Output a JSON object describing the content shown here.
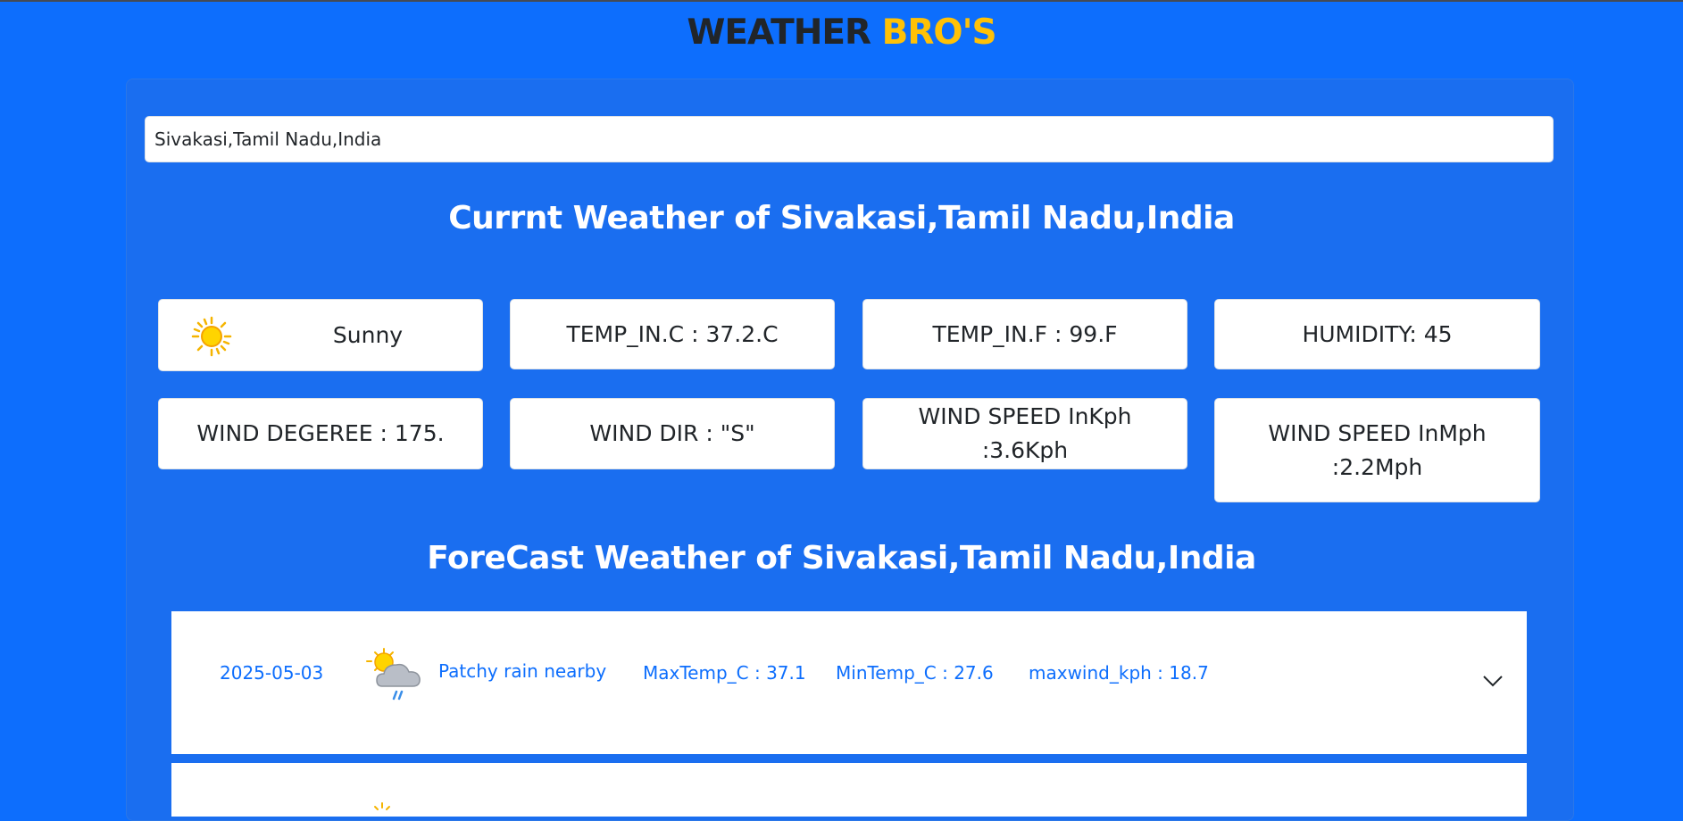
{
  "brand": {
    "part1": "WEATHER",
    "part2": "BRO'S"
  },
  "search": {
    "value": "Sivakasi,Tamil Nadu,India"
  },
  "current": {
    "title": "Currnt Weather of Sivakasi,Tamil Nadu,India",
    "condition": "Sunny",
    "temp_c": "TEMP_IN.C : 37.2.C",
    "temp_f": "TEMP_IN.F : 99.F",
    "humidity": "HUMIDITY: 45",
    "wind_degree": "WIND DEGEREE : 175.",
    "wind_dir": "WIND DIR : \"S\"",
    "wind_kph": "WIND SPEED InKph :3.6Kph",
    "wind_mph": "WIND SPEED InMph :2.2Mph"
  },
  "forecast": {
    "title": "ForeCast Weather of Sivakasi,Tamil Nadu,India",
    "items": [
      {
        "date": "2025-05-03",
        "condition": "Patchy rain nearby",
        "max_temp": "MaxTemp_C : 37.1",
        "min_temp": "MinTemp_C : 27.6",
        "max_wind": "maxwind_kph : 18.7",
        "icon": "patchy-rain-icon"
      }
    ]
  },
  "colors": {
    "background": "#0d6efd",
    "accent": "#ffc107",
    "forecast_text": "#0d6efd"
  }
}
